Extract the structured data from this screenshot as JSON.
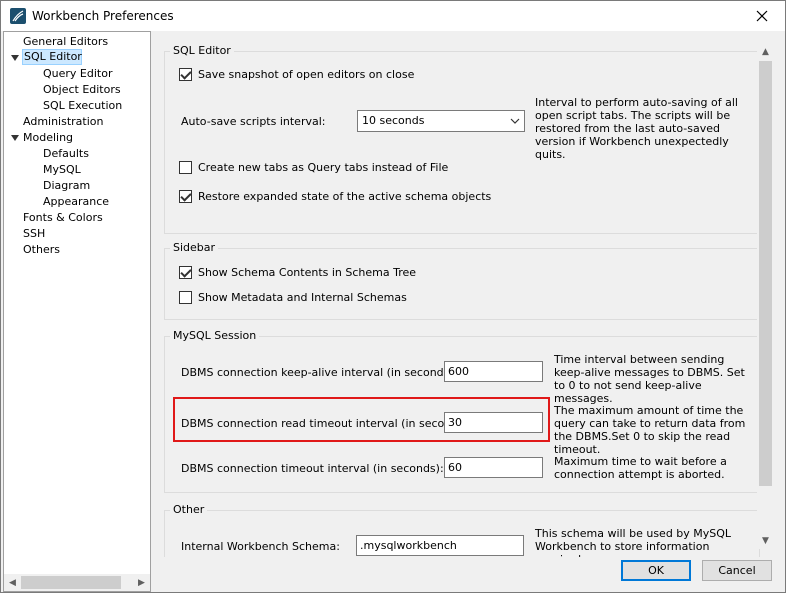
{
  "window": {
    "title": "Workbench Preferences"
  },
  "sidebar": {
    "items": [
      {
        "label": "General Editors"
      },
      {
        "label": "SQL Editor"
      },
      {
        "label": "Query Editor"
      },
      {
        "label": "Object Editors"
      },
      {
        "label": "SQL Execution"
      },
      {
        "label": "Administration"
      },
      {
        "label": "Modeling"
      },
      {
        "label": "Defaults"
      },
      {
        "label": "MySQL"
      },
      {
        "label": "Diagram"
      },
      {
        "label": "Appearance"
      },
      {
        "label": "Fonts & Colors"
      },
      {
        "label": "SSH"
      },
      {
        "label": "Others"
      }
    ],
    "selected": "SQL Editor"
  },
  "sql_editor": {
    "title": "SQL Editor",
    "save_snapshot_label": "Save snapshot of open editors on close",
    "save_snapshot_checked": true,
    "autosave_label": "Auto-save scripts interval:",
    "autosave_value": "10 seconds",
    "autosave_help": "Interval to perform auto-saving of all open script tabs. The scripts will be restored from the last auto-saved version if Workbench unexpectedly quits.",
    "new_tabs_label": "Create new tabs as Query tabs instead of File",
    "new_tabs_checked": false,
    "restore_state_label": "Restore expanded state of the active schema objects",
    "restore_state_checked": true
  },
  "sidebar_group": {
    "title": "Sidebar",
    "show_schema_contents_label": "Show Schema Contents in Schema Tree",
    "show_schema_contents_checked": true,
    "show_metadata_label": "Show Metadata and Internal Schemas",
    "show_metadata_checked": false
  },
  "mysql_session": {
    "title": "MySQL Session",
    "keepalive_label": "DBMS connection keep-alive interval (in seconds):",
    "keepalive_value": "600",
    "keepalive_help": "Time interval between sending keep-alive messages to DBMS. Set to 0 to not send keep-alive messages.",
    "read_timeout_label": "DBMS connection read timeout interval (in seconds):",
    "read_timeout_value": "30",
    "read_timeout_help": "The maximum amount of time the query can take to return data from the DBMS.Set 0 to skip the read timeout.",
    "conn_timeout_label": "DBMS connection timeout interval (in seconds):",
    "conn_timeout_value": "60",
    "conn_timeout_help": "Maximum time to wait before a connection attempt is aborted."
  },
  "other_group": {
    "title": "Other",
    "schema_label": "Internal Workbench Schema:",
    "schema_value": ".mysqlworkbench",
    "schema_help": "This schema will be used by MySQL Workbench to store information required"
  },
  "buttons": {
    "ok": "OK",
    "cancel": "Cancel"
  },
  "colors": {
    "highlight": "#e01919",
    "selection": "#cce8ff",
    "default_button": "#0078d7"
  }
}
